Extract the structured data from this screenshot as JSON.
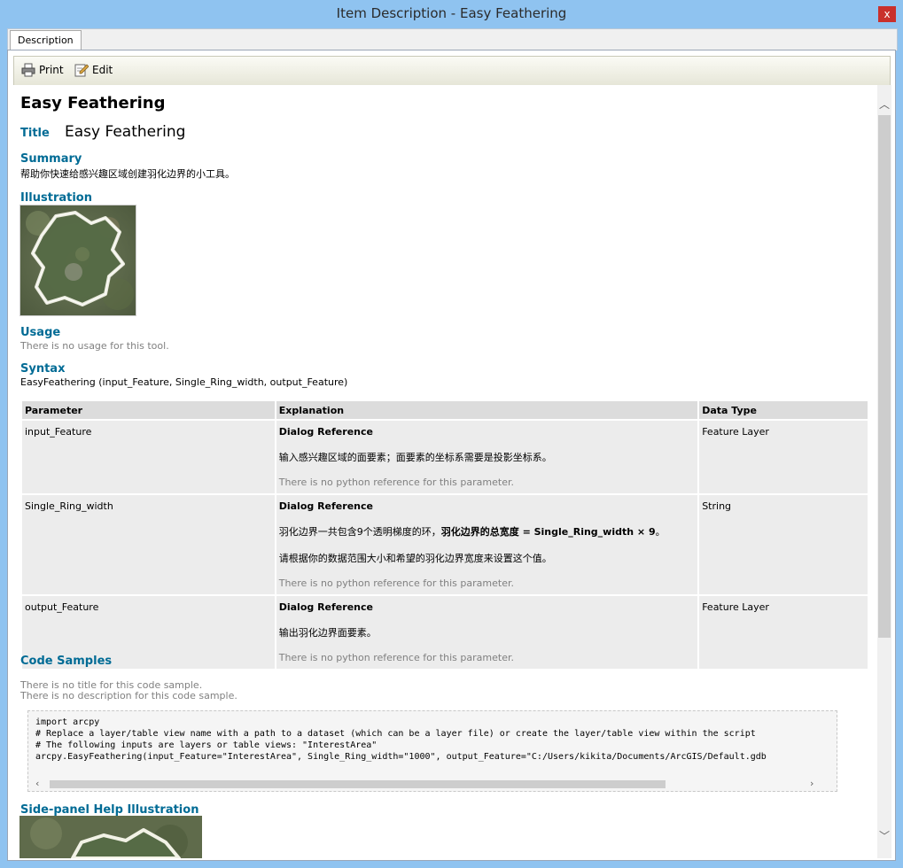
{
  "window": {
    "title": "Item Description - Easy Feathering",
    "close_glyph": "x"
  },
  "tabs": [
    {
      "label": "Description"
    }
  ],
  "toolbar": {
    "print_label": "Print",
    "edit_label": "Edit"
  },
  "doc": {
    "heading": "Easy Feathering",
    "title_label": "Title",
    "title_value": "Easy Feathering",
    "summary_label": "Summary",
    "summary_text": "帮助你快速给感兴趣区域创建羽化边界的小工具。",
    "illustration_label": "Illustration",
    "usage_label": "Usage",
    "usage_text": "There is no usage for this tool.",
    "syntax_label": "Syntax",
    "syntax_text": "EasyFeathering (input_Feature, Single_Ring_width, output_Feature)",
    "table": {
      "headers": [
        "Parameter",
        "Explanation",
        "Data Type"
      ],
      "rows": [
        {
          "param": "input_Feature",
          "dialog": "Dialog Reference",
          "desc1": "输入感兴趣区域的面要素；面要素的坐标系需要是投影坐标系。",
          "python": "There is no python reference for this parameter.",
          "type": "Feature Layer"
        },
        {
          "param": "Single_Ring_width",
          "dialog": "Dialog Reference",
          "desc1_a": "羽化边界一共包含9个透明梯度的环，",
          "desc1_b": "羽化边界的总宽度 = Single_Ring_width × 9",
          "desc1_c": "。",
          "desc2": "请根据你的数据范围大小和希望的羽化边界宽度来设置这个值。",
          "python": "There is no python reference for this parameter.",
          "type": "String"
        },
        {
          "param": "output_Feature",
          "dialog": "Dialog Reference",
          "desc1": "输出羽化边界面要素。",
          "python": "There is no python reference for this parameter.",
          "type": "Feature Layer"
        }
      ]
    },
    "code_samples_label": "Code Samples",
    "code_no_title": "There is no title for this code sample.",
    "code_no_desc": "There is no description for this code sample.",
    "code_lines": [
      "import arcpy",
      "# Replace a layer/table view name with a path to a dataset (which can be a layer file) or create the layer/table view within the script",
      "# The following inputs are layers or table views: \"InterestArea\"",
      "arcpy.EasyFeathering(input_Feature=\"InterestArea\", Single_Ring_width=\"1000\", output_Feature=\"C:/Users/kikita/Documents/ArcGIS/Default.gdb"
    ],
    "side_panel_label": "Side-panel Help Illustration"
  },
  "colors": {
    "section_heading": "#006b95",
    "window_frame": "#8fc3f0",
    "close_button": "#c9302c"
  },
  "icons": [
    "printer-icon",
    "edit-icon",
    "close-icon",
    "scroll-up-icon",
    "scroll-down-icon",
    "scroll-left-icon",
    "scroll-right-icon"
  ]
}
